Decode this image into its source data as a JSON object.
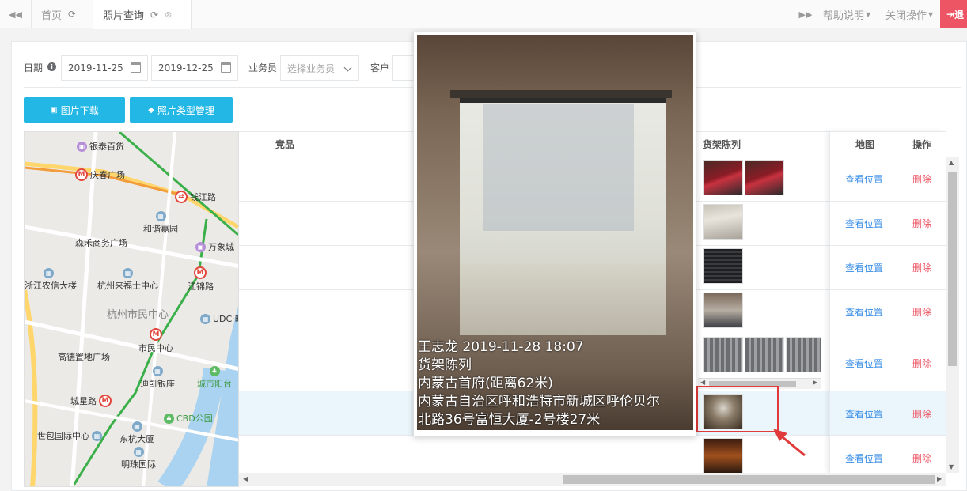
{
  "tabs": {
    "home_label": "首页",
    "active_label": "照片查询"
  },
  "header_menu": {
    "help": "帮助说明",
    "close_ops": "关闭操作",
    "logout": "退"
  },
  "filters": {
    "date_label": "日期",
    "date_start": "2019-11-25",
    "date_end": "2019-12-25",
    "salesman_label": "业务员",
    "salesman_placeholder": "选择业务员",
    "customer_label": "客户"
  },
  "buttons": {
    "download": "图片下载",
    "type_manage": "照片类型管理"
  },
  "map": {
    "pois": [
      "银泰百货",
      "庆春广场",
      "钱江路",
      "和谐嘉园",
      "森禾商务广场",
      "万象城",
      "浙江农信大楼",
      "杭州来福士中心",
      "江锦路",
      "杭州市民中心",
      "UDC·时",
      "市民中心",
      "高德置地广场",
      "迪凯银座",
      "城市阳台",
      "城星路",
      "CBD公园",
      "世包国际中心",
      "东杭大厦",
      "明珠国际"
    ]
  },
  "table": {
    "headers": {
      "col_partial": "",
      "competitor": "竞品",
      "shelf": "货架陈列",
      "map": "地图",
      "ops": "操作"
    },
    "view_label": "查看位置",
    "delete_label": "删除"
  },
  "popup": {
    "caption_line1": "王志龙  2019-11-28 18:07",
    "caption_line2": "货架陈列",
    "caption_line3": "内蒙古首府(距离62米)",
    "caption_line4": "内蒙古自治区呼和浩特市新城区呼伦贝尔",
    "caption_line5": "北路36号富恒大厦-2号楼27米"
  }
}
